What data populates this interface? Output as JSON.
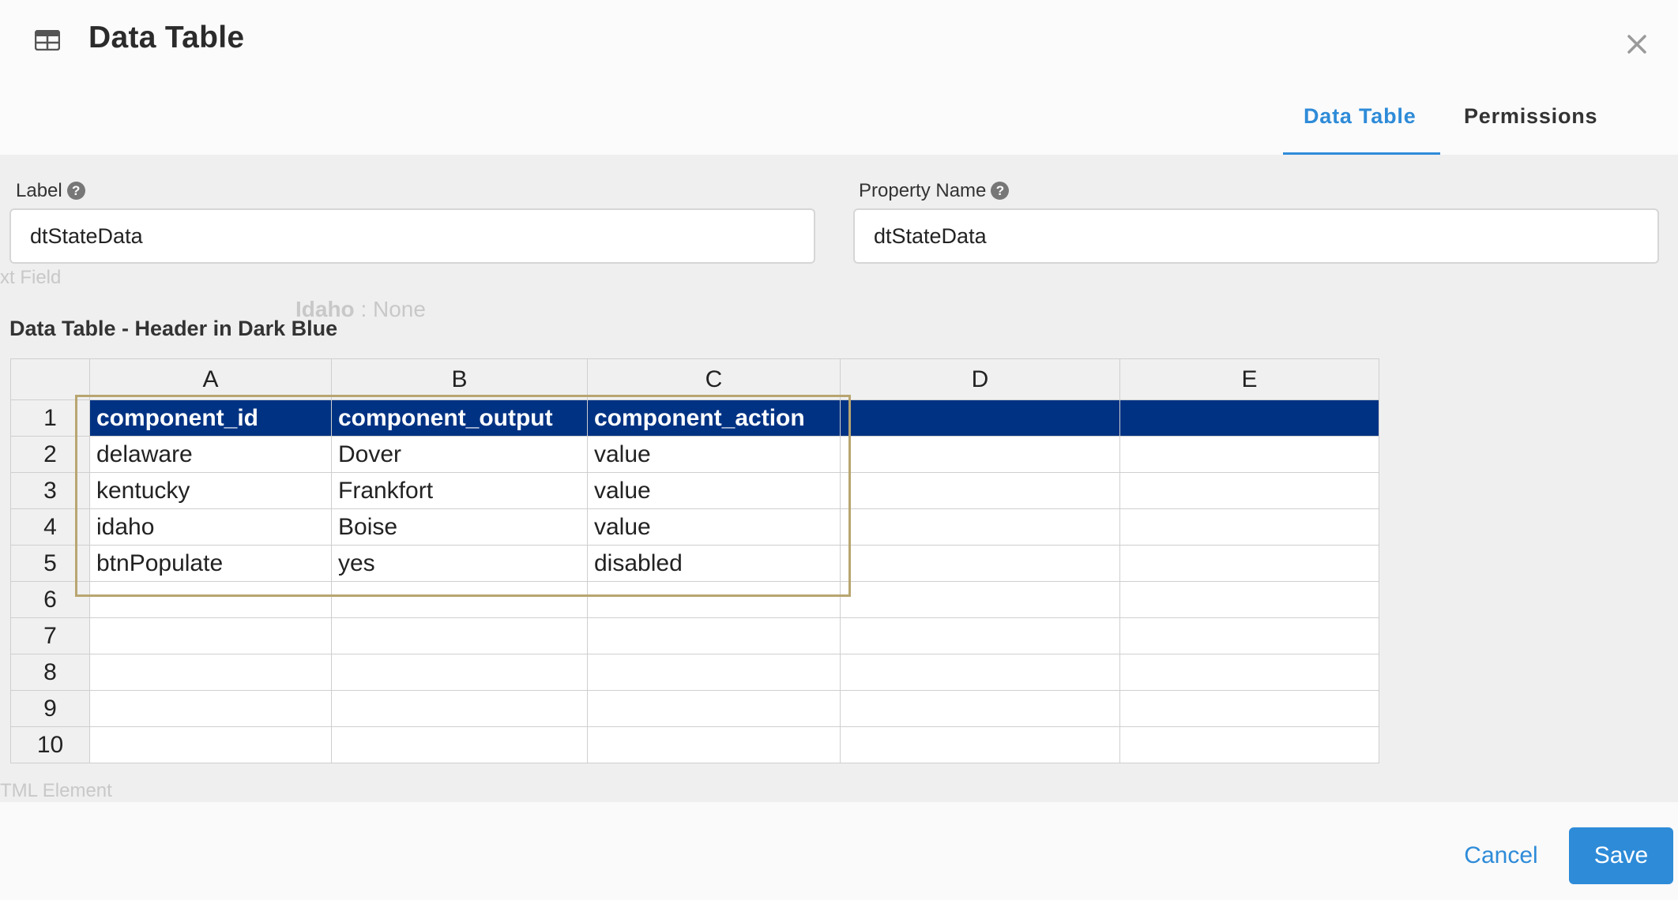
{
  "header": {
    "title": "Data Table",
    "icon": "table-icon",
    "close_icon": "close-icon"
  },
  "tabs": [
    {
      "label": "Data Table",
      "active": true
    },
    {
      "label": "Permissions",
      "active": false
    }
  ],
  "form": {
    "label": {
      "label": "Label",
      "value": "dtStateData"
    },
    "property_name": {
      "label": "Property Name",
      "value": "dtStateData"
    }
  },
  "background_ghost_text": {
    "idaho_key": "Idaho",
    "idaho_value": " : None",
    "fragment_1": "xt Field",
    "fragment_2": "TML Element"
  },
  "table_section": {
    "title": "Data Table - Header in Dark Blue",
    "header_color": "#003283",
    "column_headers": [
      "A",
      "B",
      "C",
      "D",
      "E"
    ],
    "rows": [
      {
        "num": "1",
        "cells": [
          "component_id",
          "component_output",
          "component_action",
          "",
          ""
        ]
      },
      {
        "num": "2",
        "cells": [
          "delaware",
          "Dover",
          "value",
          "",
          ""
        ]
      },
      {
        "num": "3",
        "cells": [
          "kentucky",
          "Frankfort",
          "value",
          "",
          ""
        ]
      },
      {
        "num": "4",
        "cells": [
          "idaho",
          "Boise",
          "value",
          "",
          ""
        ]
      },
      {
        "num": "5",
        "cells": [
          "btnPopulate",
          "yes",
          "disabled",
          "",
          ""
        ]
      },
      {
        "num": "6",
        "cells": [
          "",
          "",
          "",
          "",
          ""
        ]
      },
      {
        "num": "7",
        "cells": [
          "",
          "",
          "",
          "",
          ""
        ]
      },
      {
        "num": "8",
        "cells": [
          "",
          "",
          "",
          "",
          ""
        ]
      },
      {
        "num": "9",
        "cells": [
          "",
          "",
          "",
          "",
          ""
        ]
      },
      {
        "num": "10",
        "cells": [
          "",
          "",
          "",
          "",
          ""
        ]
      }
    ]
  },
  "footer": {
    "cancel_label": "Cancel",
    "save_label": "Save"
  },
  "colors": {
    "accent": "#2e8bd8",
    "highlight_border": "#b8a570"
  }
}
